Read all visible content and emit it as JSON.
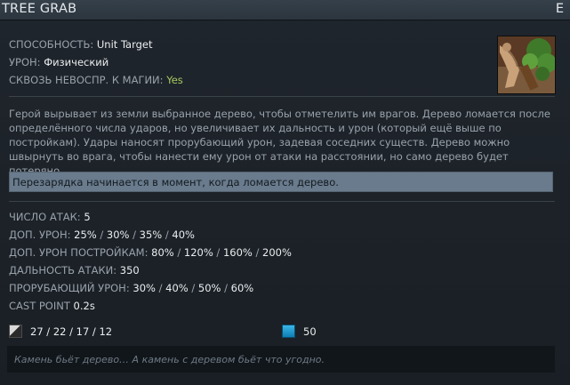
{
  "header": {
    "title": "TREE GRAB",
    "hotkey": "E"
  },
  "ability_info": {
    "ability": {
      "label": "СПОСОБНОСТЬ:",
      "value": "Unit Target"
    },
    "damage": {
      "label": "УРОН:",
      "value": "Физический"
    },
    "pierces_immunity": {
      "label": "СКВОЗЬ НЕВОСПР. К МАГИИ:",
      "value": "Yes",
      "value_color": "#a7c961"
    }
  },
  "icon": {
    "name": "tree-grab-ability-icon"
  },
  "description": "Герой вырывает из земли выбранное дерево, чтобы отметелить им врагов. Дерево ломается после определённого числа ударов, но увеличивает их дальность и урон (который ещё выше по постройкам). Удары наносят прорубающий урон, задевая соседних существ. Дерево можно швырнуть во врага, чтобы нанести ему урон от атаки на расстоянии, но само дерево будет потеряно.",
  "note": "Перезарядка начинается в момент, когда ломается дерево.",
  "stats": [
    {
      "label": "ЧИСЛО АТАК:",
      "values": [
        "5"
      ]
    },
    {
      "label": "ДОП. УРОН:",
      "values": [
        "25%",
        "30%",
        "35%",
        "40%"
      ]
    },
    {
      "label": "ДОП. УРОН ПОСТРОЙКАМ:",
      "values": [
        "80%",
        "120%",
        "160%",
        "200%"
      ]
    },
    {
      "label": "ДАЛЬНОСТЬ АТАКИ:",
      "values": [
        "350"
      ]
    },
    {
      "label": "ПРОРУБАЮЩИЙ УРОН:",
      "values": [
        "30%",
        "40%",
        "50%",
        "60%"
      ]
    },
    {
      "label": "CAST POINT",
      "values": [
        "0.2s"
      ]
    }
  ],
  "costs": {
    "cooldown": {
      "icon": "cooldown-icon",
      "value": "27 / 22 / 17 / 12"
    },
    "mana": {
      "icon": "mana-icon",
      "value": "50",
      "color": "#2aa7dc"
    }
  },
  "lore": "Камень бьёт дерево… А камень с деревом бьёт что угодно."
}
